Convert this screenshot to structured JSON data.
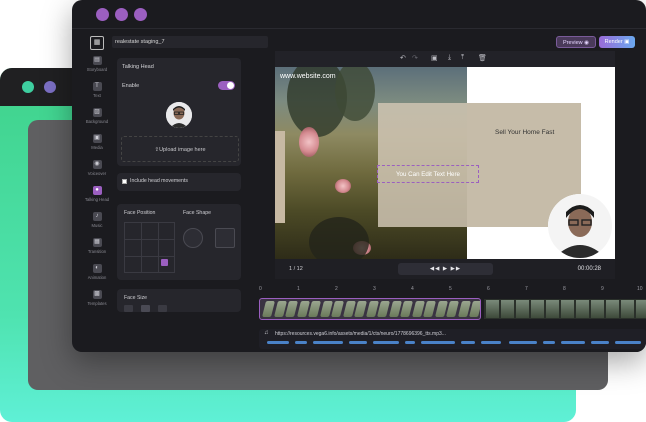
{
  "app": {
    "project_name": "realestate staging_7",
    "preview_label": "Preview",
    "render_label": "Render"
  },
  "rail": [
    {
      "label": "Storyboard",
      "icon": "storyboard-icon",
      "glyph": "▤"
    },
    {
      "label": "Text",
      "icon": "text-icon",
      "glyph": "T"
    },
    {
      "label": "Background",
      "icon": "background-icon",
      "glyph": "▨"
    },
    {
      "label": "Media",
      "icon": "media-icon",
      "glyph": "▣"
    },
    {
      "label": "Voiceover",
      "icon": "voiceover-icon",
      "glyph": "◉"
    },
    {
      "label": "Talking Head",
      "icon": "talking-head-icon",
      "glyph": "●"
    },
    {
      "label": "Music",
      "icon": "music-icon",
      "glyph": "♪"
    },
    {
      "label": "Transition",
      "icon": "transition-icon",
      "glyph": "▦"
    },
    {
      "label": "Animation",
      "icon": "animation-icon",
      "glyph": "◐"
    },
    {
      "label": "Templates",
      "icon": "templates-icon",
      "glyph": "▩"
    }
  ],
  "panel": {
    "title": "Talking Head",
    "enable_label": "Enable",
    "enable_on": true,
    "upload_label": "Upload image here",
    "head_movements_label": "Include head movements",
    "face_position_label": "Face Position",
    "face_shape_label": "Face Shape",
    "face_size_label": "Face Size"
  },
  "canvas": {
    "url_text": "www.website.com",
    "headline": "Sell Your Home Fast",
    "editable_text": "You Can Edit Text Here"
  },
  "playbar": {
    "page_indicator": "1 / 12",
    "time": "00:00:28",
    "controls": "◀◀  ▶  ▶▶"
  },
  "timeline": {
    "ticks": [
      "0",
      "1",
      "2",
      "3",
      "4",
      "5",
      "6",
      "7",
      "8",
      "9",
      "10"
    ],
    "audio_url": "https://resources.vega6.info/assets/media/1/cts/neuro/1778696396_tts.mp3..."
  },
  "colors": {
    "accent": "#9b5fc0",
    "green": "#3fd28a",
    "app_bg": "#1b1b1f"
  }
}
